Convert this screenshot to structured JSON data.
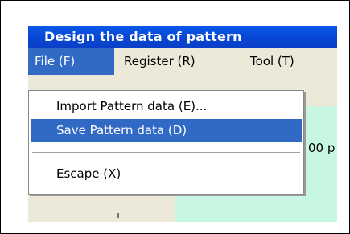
{
  "window": {
    "title": "Design the data of pattern"
  },
  "menubar": {
    "items": [
      {
        "label": "File (F)"
      },
      {
        "label": "Register (R)"
      },
      {
        "label": "Tool (T)"
      }
    ]
  },
  "dropdown": {
    "items": [
      {
        "label": "Import Pattern data (E)..."
      },
      {
        "label": "Save Pattern data (D)"
      },
      {
        "label": "Escape (X)"
      }
    ]
  },
  "content": {
    "partial_text": "00 p"
  }
}
